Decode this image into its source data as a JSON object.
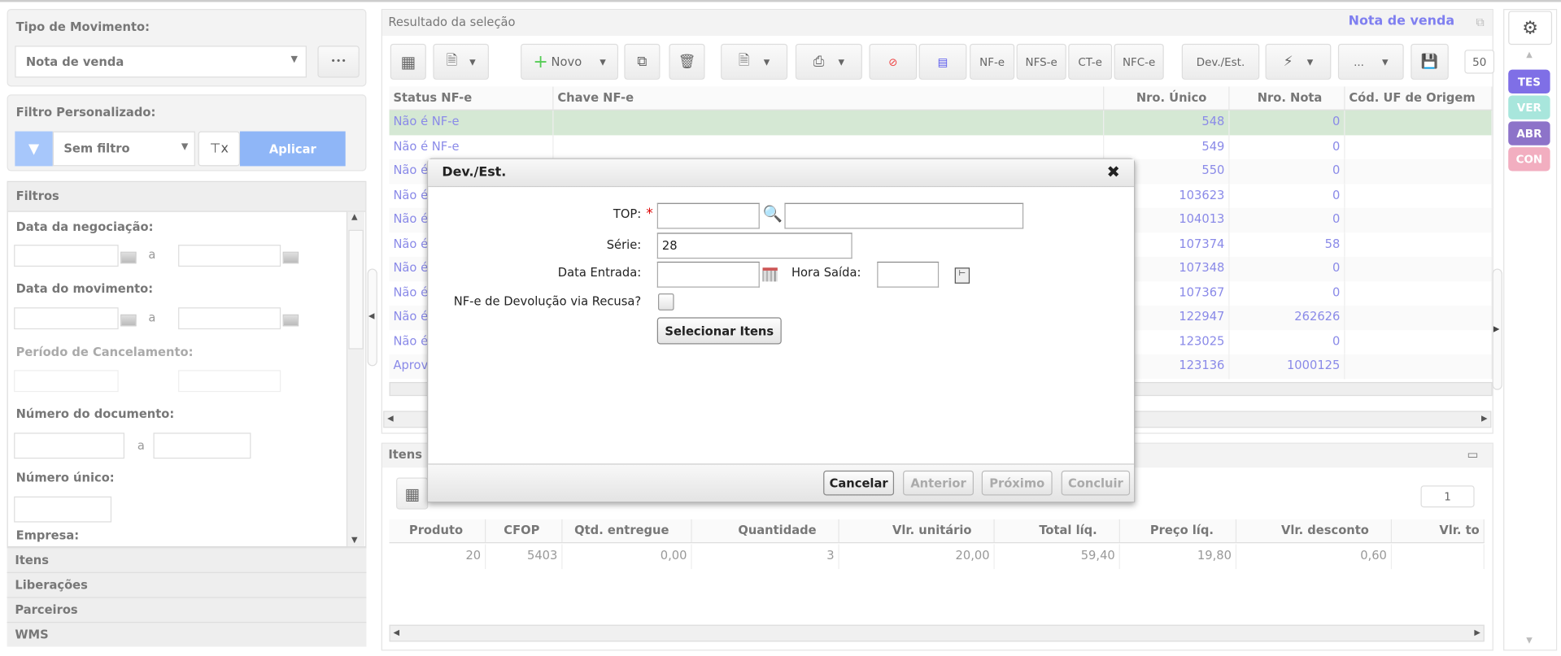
{
  "left": {
    "tipo_label": "Tipo de Movimento:",
    "tipo_value": "Nota de venda",
    "more": "•••",
    "filtro_label": "Filtro Personalizado:",
    "filtro_value": "Sem filtro",
    "aplicar": "Aplicar",
    "filtros": "Filtros",
    "f_neg": "Data da negociação:",
    "f_mov": "Data do movimento:",
    "f_canc": "Período de Cancelamento:",
    "f_doc": "Número do documento:",
    "f_unico": "Número único:",
    "f_emp": "Empresa:",
    "a": "a",
    "sections": [
      "Itens",
      "Liberações",
      "Parceiros",
      "WMS"
    ]
  },
  "main": {
    "title": "Resultado da seleção",
    "context": "Nota de venda",
    "toolbar": {
      "novo": "Novo",
      "nfe": "NF-e",
      "nfse": "NFS-e",
      "cte": "CT-e",
      "nfce": "NFC-e",
      "devest": "Dev./Est.",
      "more": "...",
      "page_size": "50"
    },
    "columns": [
      "Status NF-e",
      "Chave NF-e",
      "Nro. Único",
      "Nro. Nota",
      "Cód. UF de Origem"
    ],
    "rows": [
      [
        "Não é NF-e",
        "",
        "548",
        "0"
      ],
      [
        "Não é NF-e",
        "",
        "549",
        "0"
      ],
      [
        "Não é NF-e",
        "",
        "550",
        "0"
      ],
      [
        "Não é NF-e",
        "",
        "103623",
        "0"
      ],
      [
        "Não é NF-e",
        "",
        "104013",
        "0"
      ],
      [
        "Não é NF-e",
        "",
        "107374",
        "58"
      ],
      [
        "Não é NF-e",
        "",
        "107348",
        "0"
      ],
      [
        "Não é NF-e",
        "",
        "107367",
        "0"
      ],
      [
        "Não é NF-e",
        "",
        "122947",
        "262626"
      ],
      [
        "Não é NF-e",
        "",
        "123025",
        "0"
      ],
      [
        "Aprov",
        "",
        "123136",
        "1000125"
      ]
    ]
  },
  "items": {
    "title": "Itens",
    "page": "1",
    "columns": [
      "Produto",
      "CFOP",
      "Qtd. entregue",
      "Quantidade",
      "Vlr. unitário",
      "Total líq.",
      "Preço líq.",
      "Vlr. desconto",
      "Vlr. to"
    ],
    "rows": [
      [
        "20",
        "5403",
        "0,00",
        "3",
        "20,00",
        "59,40",
        "19,80",
        "0,60",
        ""
      ]
    ]
  },
  "rail": {
    "tags": [
      {
        "label": "TES",
        "color": "#7f6fe6"
      },
      {
        "label": "VER",
        "color": "#a8e6dc"
      },
      {
        "label": "ABR",
        "color": "#8d73c9"
      },
      {
        "label": "CON",
        "color": "#f2aec0"
      }
    ]
  },
  "dialog": {
    "title": "Dev./Est.",
    "close": "✖",
    "top_label": "TOP:",
    "required": "*",
    "top_code": "",
    "top_desc": "",
    "serie_label": "Série:",
    "serie_value": "28",
    "data_label": "Data Entrada:",
    "data_value": "",
    "hora_label": "Hora Saída:",
    "hora_value": "",
    "recusa_label": "NF-e de Devolução via Recusa?",
    "selecionar": "Selecionar Itens",
    "cancelar": "Cancelar",
    "anterior": "Anterior",
    "proximo": "Próximo",
    "concluir": "Concluir"
  }
}
